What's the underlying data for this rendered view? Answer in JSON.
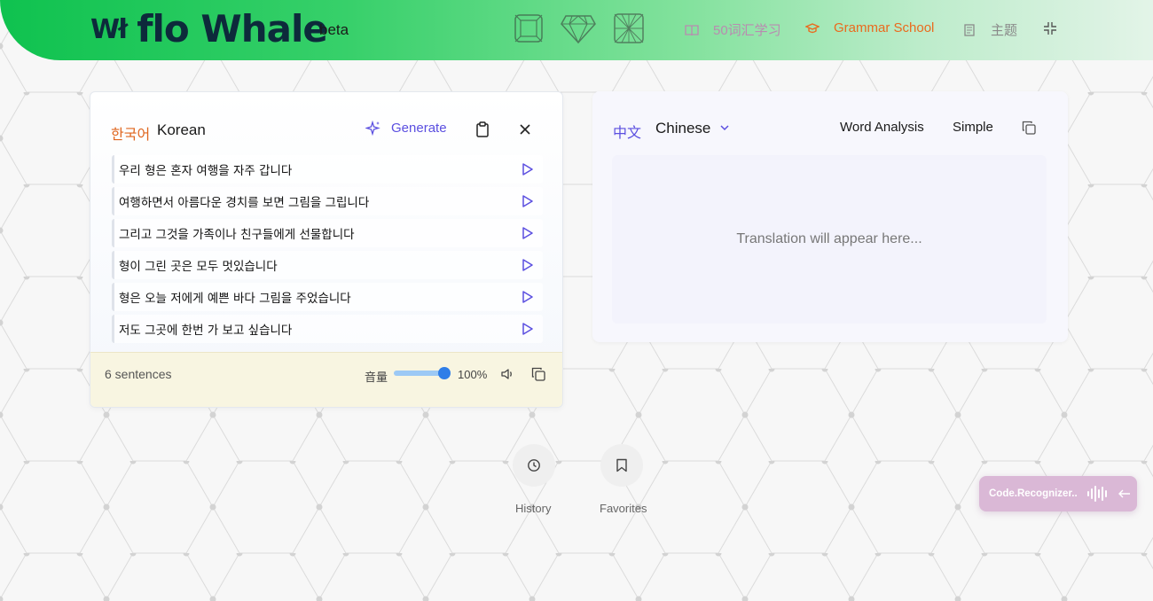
{
  "header": {
    "logo_mark": "Wł",
    "logo_text": "flo Whale",
    "beta": "beta",
    "nav": [
      {
        "label": "50词汇学习",
        "icon": "book-icon",
        "color": "#b98bb0"
      },
      {
        "label": "Grammar School",
        "icon": "graduation-cap-icon",
        "color": "#ea6a1d"
      },
      {
        "label": "主题",
        "icon": "document-icon",
        "color": "#8a8a8a"
      }
    ],
    "gem_icons": [
      "square-gem-icon",
      "diamond-icon",
      "round-gem-icon"
    ],
    "collapse_icon": "collapse-icon",
    "brand_color": "#0fc24f"
  },
  "source": {
    "native_name": "한국어",
    "name": "Korean",
    "generate_label": "Generate",
    "sentences": [
      "우리 형은 혼자 여행을 자주 갑니다",
      "여행하면서 아름다운 경치를 보면 그림을 그립니다",
      "그리고 그것을 가족이나 친구들에게 선물합니다",
      "형이 그린 곳은 모두 멋있습니다",
      "형은 오늘 저에게 예쁜 바다 그림을 주었습니다",
      "저도 그곳에 한번 가 보고 싶습니다"
    ],
    "footer": {
      "count_label": "6 sentences",
      "volume_label": "音量",
      "volume_percent": "100%",
      "volume_value": 1.0
    },
    "accent_color": "#5b4fe0"
  },
  "target": {
    "native_name": "中文",
    "name": "Chinese",
    "word_analysis_label": "Word Analysis",
    "simple_label": "Simple",
    "placeholder": "Translation will appear here..."
  },
  "bottom": {
    "history_label": "History",
    "favorites_label": "Favorites"
  },
  "widget": {
    "label": "Code.Recognizer.."
  }
}
